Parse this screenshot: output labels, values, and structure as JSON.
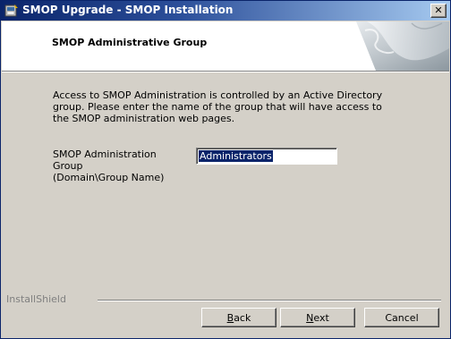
{
  "window": {
    "title": "SMOP Upgrade - SMOP Installation",
    "close_glyph": "✕",
    "icon": "installer-icon"
  },
  "banner": {
    "title": "SMOP Administrative Group",
    "art": "page-curl-icon"
  },
  "description": "Access to SMOP Administration is controlled by an Active Directory group. Please enter the name of the group that will have access to the SMOP administration web pages.",
  "group_field": {
    "label_line1": "SMOP Administration Group",
    "label_line2": "(Domain\\Group Name)",
    "value": "Administrators"
  },
  "footer": {
    "brand": "InstallShield",
    "back_label": "Back",
    "next_label": "Next",
    "cancel_label": "Cancel"
  },
  "colors": {
    "title_bar": "#0a246a",
    "dialog_bg": "#d4d0c8",
    "selection": "#0a246a"
  }
}
